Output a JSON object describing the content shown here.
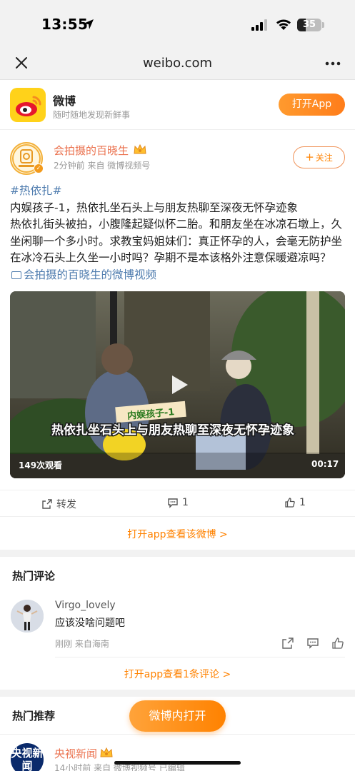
{
  "status_bar": {
    "time": "13:55",
    "battery": "35",
    "battery_level_percent": 35,
    "icons": [
      "location-arrow-icon",
      "cellular-signal-icon",
      "wifi-icon",
      "battery-icon"
    ]
  },
  "browser": {
    "url": "weibo.com",
    "close_icon": "close-icon",
    "more_icon": "more-dots-icon"
  },
  "app_banner": {
    "name": "微博",
    "slogan": "随时随地发现新鲜事",
    "open_button": "打开App"
  },
  "post": {
    "author": "会拍摄的百晓生",
    "meta": "2分钟前  来自 微博视频号",
    "follow_button": "关注",
    "hashtag": "#热依扎#",
    "text_line1": "内娱孩子-1，热依扎坐石头上与朋友热聊至深夜无怀孕迹象",
    "text_rest": "热依扎街头被拍，小腹隆起疑似怀二胎。和朋友坐在冰凉石墩上，久坐闲聊一个多小时。求教宝妈姐妹们：真正怀孕的人，会毫无防护坐在冰冷石头上久坐一小时吗？孕期不是本该格外注意保暖避凉吗？",
    "video_link": "会拍摄的百晓生的微博视频",
    "video": {
      "views": "149次观看",
      "duration": "00:17",
      "caption_tag": "内娱孩子-1",
      "caption_subtitle": "热依扎坐石头上与朋友热聊至深夜无怀孕迹象"
    },
    "actions": {
      "repost": "转发",
      "comments": "1",
      "likes": "1"
    },
    "open_app_link": "打开app查看该微博 >"
  },
  "hot_comments": {
    "title": "热门评论",
    "items": [
      {
        "user": "Virgo_lovely",
        "text": "应该没啥问题吧",
        "meta": "刚刚  来自海南"
      }
    ],
    "open_link": "打开app查看1条评论 >"
  },
  "hot_recommend": {
    "title": "热门推荐",
    "items": [
      {
        "author": "央视新闻",
        "avatar_text": "央视新闻",
        "meta": "14小时前  来自 微博视频号 已编辑"
      }
    ]
  },
  "float_button": "微博内打开",
  "colors": {
    "accent_orange": "#ff8200",
    "username_orange": "#eb7350",
    "link_blue": "#507daf",
    "weibo_yellow": "#ffd21a"
  }
}
